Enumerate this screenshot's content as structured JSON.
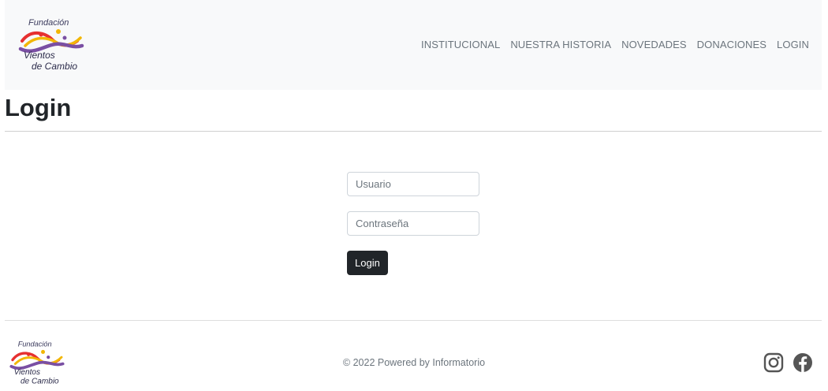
{
  "brand": {
    "line1": "Fundación",
    "line2": "Vientos",
    "line3": "de Cambio",
    "colors": {
      "red": "#e63030",
      "yellow": "#f2b705",
      "purple": "#7a4fa3"
    }
  },
  "nav": {
    "items": [
      {
        "label": "INSTITUCIONAL"
      },
      {
        "label": "NUESTRA HISTORIA"
      },
      {
        "label": "NOVEDADES"
      },
      {
        "label": "DONACIONES"
      },
      {
        "label": "LOGIN"
      }
    ]
  },
  "page": {
    "title": "Login"
  },
  "form": {
    "username_placeholder": "Usuario",
    "username_value": "",
    "password_placeholder": "Contraseña",
    "password_value": "",
    "submit_label": "Login"
  },
  "footer": {
    "copyright": "© 2022 Powered by Informatorio",
    "social": [
      {
        "icon": "instagram-icon"
      },
      {
        "icon": "facebook-icon"
      }
    ]
  }
}
